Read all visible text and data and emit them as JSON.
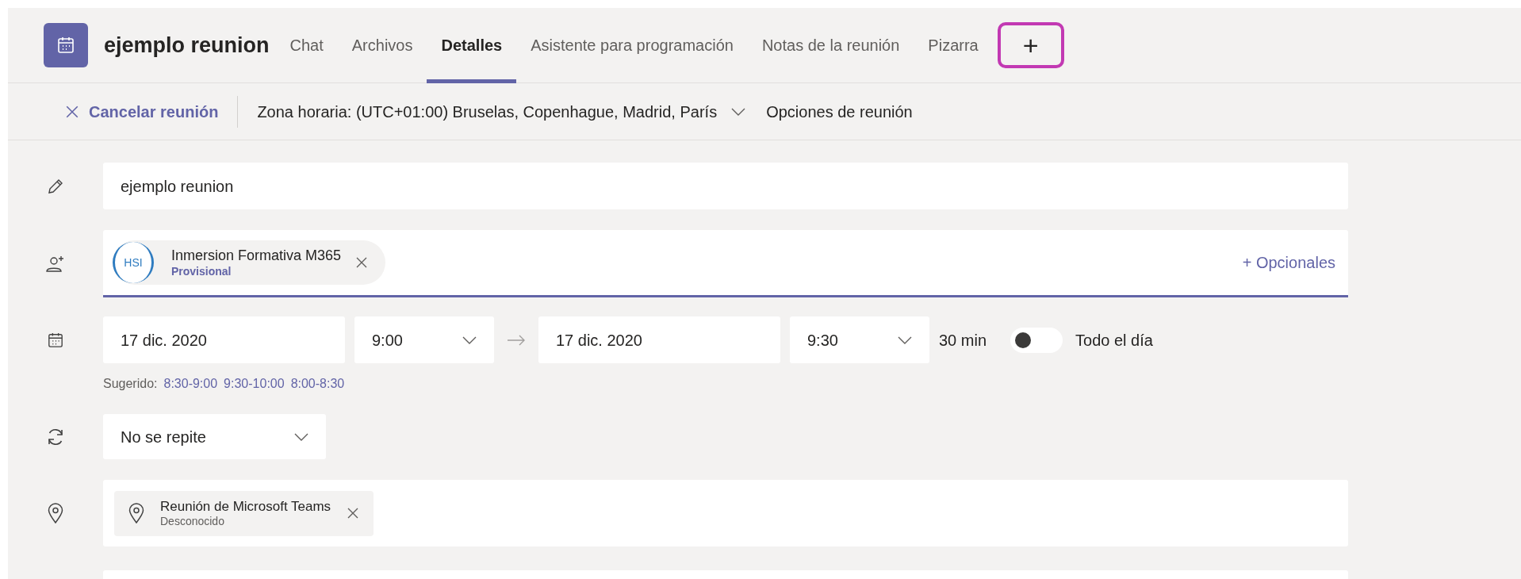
{
  "header": {
    "title": "ejemplo reunion",
    "tabs": [
      {
        "label": "Chat",
        "selected": false
      },
      {
        "label": "Archivos",
        "selected": false
      },
      {
        "label": "Detalles",
        "selected": true
      },
      {
        "label": "Asistente para programación",
        "selected": false
      },
      {
        "label": "Notas de la reunión",
        "selected": false
      },
      {
        "label": "Pizarra",
        "selected": false
      }
    ],
    "add_tab": "+"
  },
  "toolbar": {
    "cancel": "Cancelar reunión",
    "timezone": "Zona horaria: (UTC+01:00) Bruselas, Copenhague, Madrid, París",
    "options": "Opciones de reunión"
  },
  "form": {
    "title_value": "ejemplo reunion",
    "attendees": [
      {
        "name": "Inmersion Formativa M365",
        "status": "Provisional",
        "logo": "HSI"
      }
    ],
    "optional_link": "+ Opcionales",
    "start_date": "17 dic. 2020",
    "start_time": "9:00",
    "end_date": "17 dic. 2020",
    "end_time": "9:30",
    "duration": "30 min",
    "all_day": {
      "label": "Todo el día",
      "on": false
    },
    "suggested_label": "Sugerido:",
    "suggestions": [
      "8:30-9:00",
      "9:30-10:00",
      "8:00-8:30"
    ],
    "repeat": "No se repite",
    "location": {
      "name": "Reunión de Microsoft Teams",
      "status": "Desconocido"
    }
  }
}
